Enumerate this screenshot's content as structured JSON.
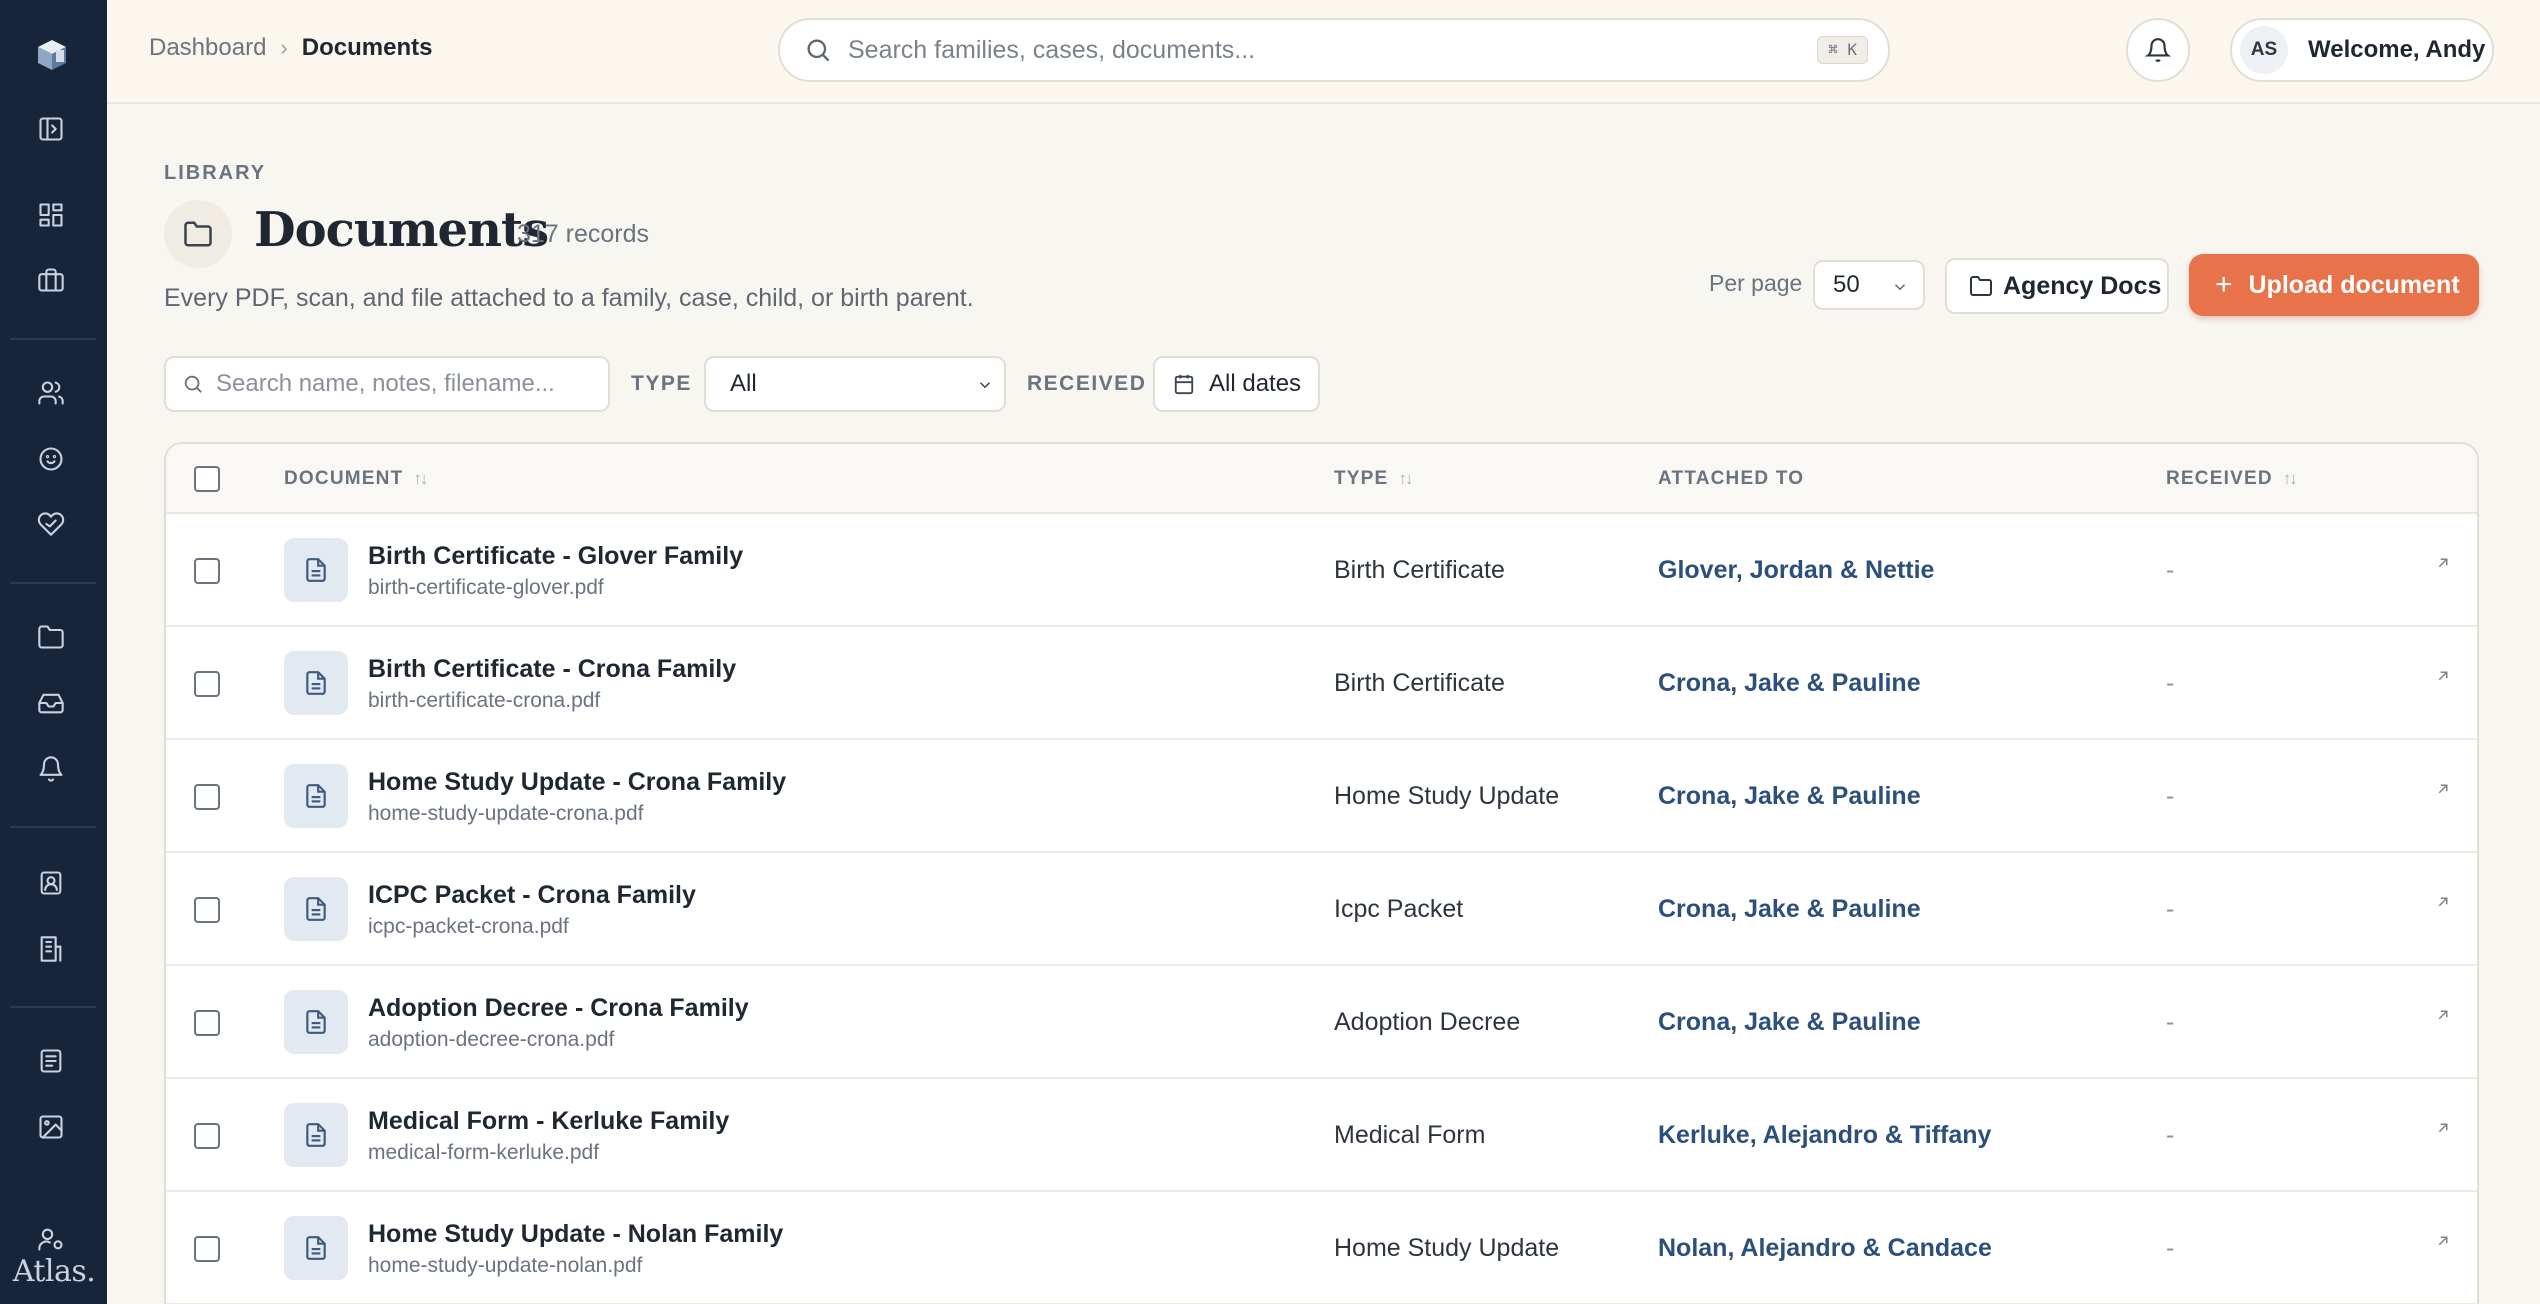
{
  "sidebar": {
    "brand": "Atlas."
  },
  "topbar": {
    "breadcrumb": {
      "parent": "Dashboard",
      "current": "Documents"
    },
    "search_placeholder": "Search families, cases, documents...",
    "shortcut": "⌘ K",
    "user_initials": "AS",
    "welcome": "Welcome, Andy"
  },
  "page": {
    "eyebrow": "LIBRARY",
    "title": "Documents",
    "records": "317 records",
    "subtitle": "Every PDF, scan, and file attached to a family, case, child, or birth parent.",
    "per_page_label": "Per page",
    "per_page_value": "50",
    "agency_docs": "Agency Docs",
    "upload": "Upload document"
  },
  "filters": {
    "search_placeholder": "Search name, notes, filename...",
    "type_label": "TYPE",
    "type_value": "All",
    "received_label": "RECEIVED",
    "dates_value": "All dates"
  },
  "table": {
    "headers": {
      "document": "DOCUMENT",
      "type": "TYPE",
      "attached": "ATTACHED TO",
      "received": "RECEIVED"
    },
    "rows": [
      {
        "name": "Birth Certificate - Glover Family",
        "file": "birth-certificate-glover.pdf",
        "type": "Birth Certificate",
        "attached": "Glover, Jordan & Nettie",
        "received": "-"
      },
      {
        "name": "Birth Certificate - Crona Family",
        "file": "birth-certificate-crona.pdf",
        "type": "Birth Certificate",
        "attached": "Crona, Jake & Pauline",
        "received": "-"
      },
      {
        "name": "Home Study Update - Crona Family",
        "file": "home-study-update-crona.pdf",
        "type": "Home Study Update",
        "attached": "Crona, Jake & Pauline",
        "received": "-"
      },
      {
        "name": "ICPC Packet - Crona Family",
        "file": "icpc-packet-crona.pdf",
        "type": "Icpc Packet",
        "attached": "Crona, Jake & Pauline",
        "received": "-"
      },
      {
        "name": "Adoption Decree - Crona Family",
        "file": "adoption-decree-crona.pdf",
        "type": "Adoption Decree",
        "attached": "Crona, Jake & Pauline",
        "received": "-"
      },
      {
        "name": "Medical Form - Kerluke Family",
        "file": "medical-form-kerluke.pdf",
        "type": "Medical Form",
        "attached": "Kerluke, Alejandro & Tiffany",
        "received": "-"
      },
      {
        "name": "Home Study Update - Nolan Family",
        "file": "home-study-update-nolan.pdf",
        "type": "Home Study Update",
        "attached": "Nolan, Alejandro & Candace",
        "received": "-"
      }
    ]
  }
}
